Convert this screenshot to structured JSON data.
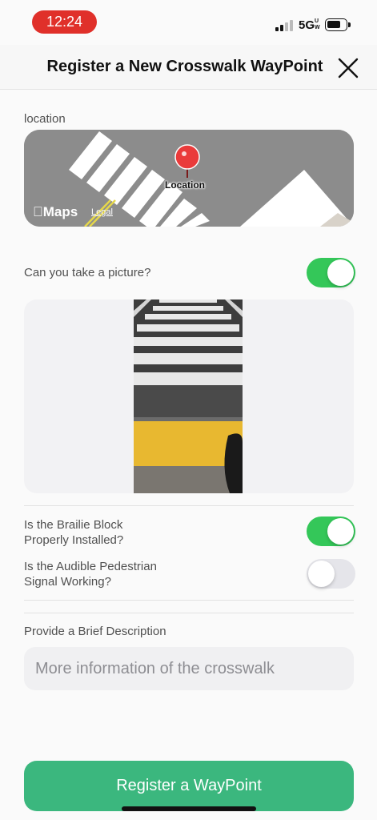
{
  "status_bar": {
    "time": "12:24",
    "network": "5G",
    "network_sup": "UW"
  },
  "header": {
    "title": "Register a New Crosswalk WayPoint"
  },
  "location": {
    "label": "location",
    "pin_label": "Location",
    "maps_logo": "Maps",
    "legal": "Legal"
  },
  "picture": {
    "question": "Can you take a picture?",
    "enabled": true
  },
  "braille": {
    "question_line1": "Is the Brailie Block",
    "question_line2": "Properly Installed?",
    "enabled": true
  },
  "audible": {
    "question_line1": "Is the Audible Pedestrian",
    "question_line2": "Signal Working?",
    "enabled": false
  },
  "description": {
    "label": "Provide a Brief Description",
    "placeholder": "More information of the crosswalk",
    "value": ""
  },
  "submit": {
    "label": "Register a WayPoint"
  },
  "colors": {
    "accent_green": "#3bb77e",
    "toggle_on": "#34c759",
    "time_pill": "#e0302a"
  }
}
